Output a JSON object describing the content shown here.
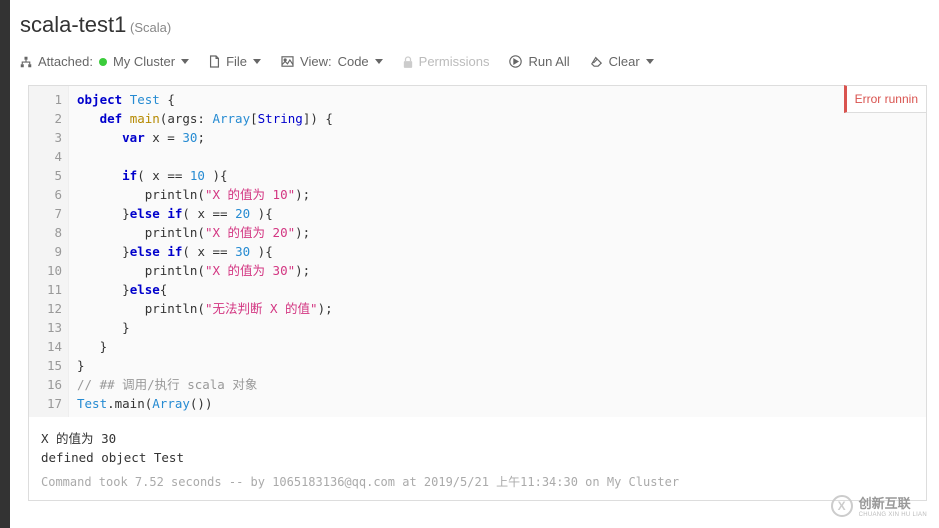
{
  "header": {
    "title": "scala-test1",
    "lang": "(Scala)"
  },
  "toolbar": {
    "attached_label": "Attached:",
    "cluster": "My Cluster",
    "file_label": "File",
    "view_label": "View:",
    "view_mode": "Code",
    "permissions_label": "Permissions",
    "runall_label": "Run All",
    "clear_label": "Clear"
  },
  "error_tab": "Error runnin",
  "code": {
    "lines": [
      {
        "n": 1,
        "tokens": [
          [
            "kw",
            "object"
          ],
          [
            "plain",
            " "
          ],
          [
            "cls",
            "Test"
          ],
          [
            "plain",
            " {"
          ]
        ]
      },
      {
        "n": 2,
        "tokens": [
          [
            "plain",
            "   "
          ],
          [
            "kw",
            "def"
          ],
          [
            "plain",
            " "
          ],
          [
            "fn",
            "main"
          ],
          [
            "plain",
            "(args: "
          ],
          [
            "cls",
            "Array"
          ],
          [
            "plain",
            "["
          ],
          [
            "typ",
            "String"
          ],
          [
            "plain",
            "]) {"
          ]
        ]
      },
      {
        "n": 3,
        "tokens": [
          [
            "plain",
            "      "
          ],
          [
            "kw",
            "var"
          ],
          [
            "plain",
            " x = "
          ],
          [
            "num",
            "30"
          ],
          [
            "plain",
            ";"
          ]
        ]
      },
      {
        "n": 4,
        "tokens": [
          [
            "plain",
            ""
          ]
        ]
      },
      {
        "n": 5,
        "tokens": [
          [
            "plain",
            "      "
          ],
          [
            "kw",
            "if"
          ],
          [
            "plain",
            "( x == "
          ],
          [
            "num",
            "10"
          ],
          [
            "plain",
            " ){"
          ]
        ]
      },
      {
        "n": 6,
        "tokens": [
          [
            "plain",
            "         println("
          ],
          [
            "str",
            "\"X 的值为 10\""
          ],
          [
            "plain",
            ");"
          ]
        ]
      },
      {
        "n": 7,
        "tokens": [
          [
            "plain",
            "      }"
          ],
          [
            "kw",
            "else"
          ],
          [
            "plain",
            " "
          ],
          [
            "kw",
            "if"
          ],
          [
            "plain",
            "( x == "
          ],
          [
            "num",
            "20"
          ],
          [
            "plain",
            " ){"
          ]
        ]
      },
      {
        "n": 8,
        "tokens": [
          [
            "plain",
            "         println("
          ],
          [
            "str",
            "\"X 的值为 20\""
          ],
          [
            "plain",
            ");"
          ]
        ]
      },
      {
        "n": 9,
        "tokens": [
          [
            "plain",
            "      }"
          ],
          [
            "kw",
            "else"
          ],
          [
            "plain",
            " "
          ],
          [
            "kw",
            "if"
          ],
          [
            "plain",
            "( x == "
          ],
          [
            "num",
            "30"
          ],
          [
            "plain",
            " ){"
          ]
        ]
      },
      {
        "n": 10,
        "tokens": [
          [
            "plain",
            "         println("
          ],
          [
            "str",
            "\"X 的值为 30\""
          ],
          [
            "plain",
            ");"
          ]
        ]
      },
      {
        "n": 11,
        "tokens": [
          [
            "plain",
            "      }"
          ],
          [
            "kw",
            "else"
          ],
          [
            "plain",
            "{"
          ]
        ]
      },
      {
        "n": 12,
        "tokens": [
          [
            "plain",
            "         println("
          ],
          [
            "str",
            "\"无法判断 X 的值\""
          ],
          [
            "plain",
            ");"
          ]
        ]
      },
      {
        "n": 13,
        "tokens": [
          [
            "plain",
            "      }"
          ]
        ]
      },
      {
        "n": 14,
        "tokens": [
          [
            "plain",
            "   }"
          ]
        ]
      },
      {
        "n": 15,
        "tokens": [
          [
            "plain",
            "}"
          ]
        ]
      },
      {
        "n": 16,
        "tokens": [
          [
            "cmt",
            "// ## 调用/执行 scala 对象"
          ]
        ]
      },
      {
        "n": 17,
        "tokens": [
          [
            "cls",
            "Test"
          ],
          [
            "plain",
            ".main("
          ],
          [
            "cls",
            "Array"
          ],
          [
            "plain",
            "())"
          ]
        ]
      }
    ]
  },
  "output": {
    "line1": "X 的值为 30",
    "line2": "defined object Test"
  },
  "meta": "Command took 7.52 seconds -- by 1065183136@qq.com at 2019/5/21 上午11:34:30 on My Cluster",
  "watermark": {
    "cn": "创新互联",
    "en": "CHUANG XIN HU LIAN"
  }
}
